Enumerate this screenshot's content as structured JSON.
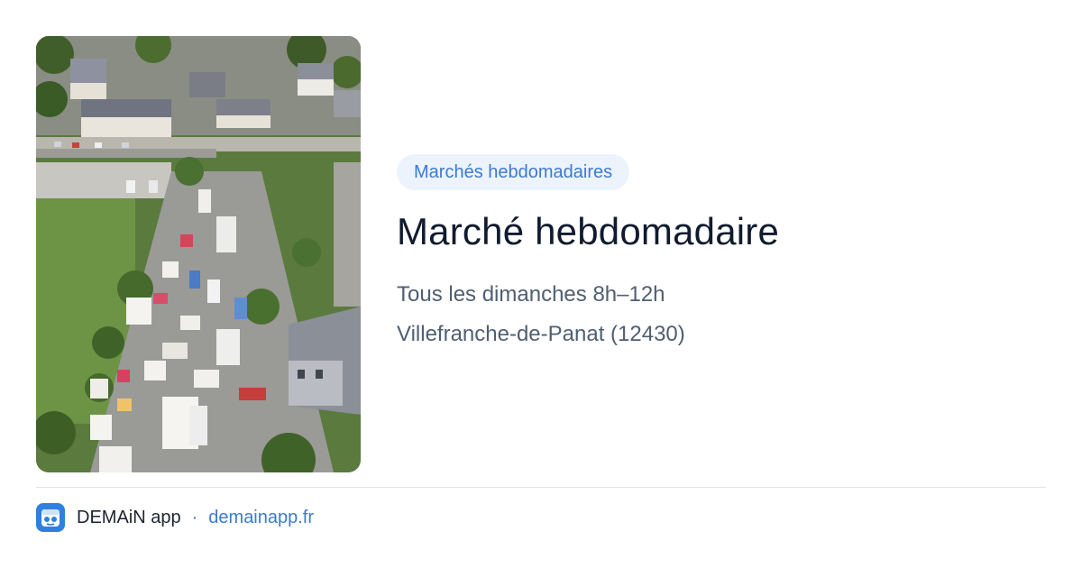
{
  "card": {
    "category_badge": "Marchés hebdomadaires",
    "title": "Marché hebdomadaire",
    "schedule": "Tous les dimanches 8h–12h",
    "location": "Villefranche-de-Panat (12430)"
  },
  "image": {
    "subject": "aerial-photo-of-outdoor-market"
  },
  "footer": {
    "app_name": "DEMAiN app",
    "separator": "·",
    "site_link": "demainapp.fr"
  },
  "colors": {
    "accent": "#3b7ad0",
    "badge_bg": "#edf3fc",
    "title": "#111b2f",
    "body_text": "#4f5f72",
    "logo_bg": "#2f7fe0"
  }
}
